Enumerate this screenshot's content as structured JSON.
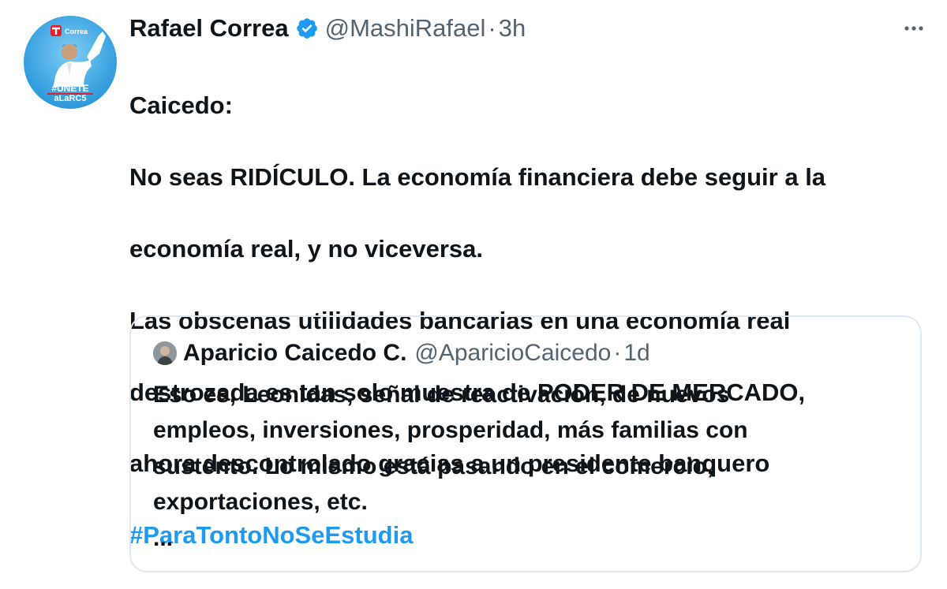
{
  "tweet": {
    "author_name": "Rafael Correa",
    "handle": "@MashiRafael",
    "separator": "·",
    "time": "3h",
    "avatar": {
      "logo_text": "Correa",
      "badge_text_1": "#UNETE",
      "badge_text_2": "aLaRC5"
    },
    "verified_icon": "verified-badge-icon",
    "more_icon": "more-options-icon",
    "body_lines": [
      "Caicedo:",
      "No seas RIDÍCULO. La economía financiera debe seguir a la",
      "economía real, y no viceversa.",
      "Las obscenas utilidades bancarias en una economía real",
      "destrozada es tan solo muestra de PODER DE MERCADO,",
      "ahora descontrolado gracias a un presidente banquero"
    ],
    "hashtag": "#ParaTontoNoSeEstudia"
  },
  "quoted_tweet": {
    "author_name": "Aparicio Caicedo C.",
    "handle": "@AparicioCaicedo",
    "separator": "·",
    "time": "1d",
    "body_lines": [
      "Eso es, Leonidas, señal de reactivación, de nuevos",
      "empleos, inversiones, prosperidad, más familias con",
      "sustento. Lo mismo está pasando en el comercio,",
      "exportaciones, etc.",
      "..."
    ]
  },
  "colors": {
    "text": "#0f1419",
    "secondary": "#536471",
    "accent": "#1d9bf0",
    "border": "#e1e8ed"
  }
}
